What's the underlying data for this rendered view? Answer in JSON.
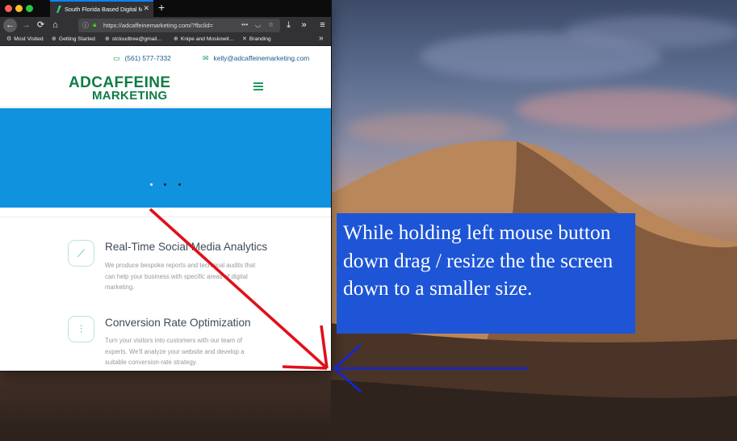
{
  "browser": {
    "tab_title": "South Florida Based Digital Ma",
    "tab_close": "✕",
    "new_tab": "+",
    "url": "https://adcaffeinemarketing.com/?fbclid=",
    "colors": {
      "tab_accent": "#0a84ff",
      "lock": "#30e60b"
    },
    "bookmarks": [
      {
        "label": "Most Visited",
        "icon": "gear-icon"
      },
      {
        "label": "Getting Started",
        "icon": "globe-icon"
      },
      {
        "label": "stcloudtree@gmail...",
        "icon": "globe-icon"
      },
      {
        "label": "Knipe and Moskowit...",
        "icon": "globe-icon"
      },
      {
        "label": "Branding",
        "icon": "x-icon"
      }
    ]
  },
  "site": {
    "phone": "(561) 577-7332",
    "email": "kelly@adcaffeinemarketing.com",
    "logo_line1": "ADCAFFEINE",
    "logo_line2": "MARKETING",
    "services": [
      {
        "title": "Real-Time Social Media Analytics",
        "description": "We produce bespoke reports and technical audits that can help your business with specific areas of digital marketing.",
        "icon": "chart-line-icon"
      },
      {
        "title": "Conversion Rate Optimization",
        "description": "Turn your visitors into customers with our team of experts. We'll analyze your website and develop a suitable conversion-rate strategy.",
        "icon": "sliders-icon"
      }
    ],
    "colors": {
      "brand_green": "#0e7d45",
      "hero_blue": "#1192df"
    }
  },
  "callout": {
    "text": "While holding left mouse button down drag / resize the the screen down to a smaller size.",
    "color": "#1d55d6"
  }
}
